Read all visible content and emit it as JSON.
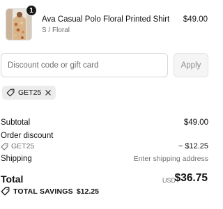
{
  "product": {
    "name": "Ava Casual Polo Floral Printed Shirt",
    "variant": "S / Floral",
    "price": "$49.00",
    "quantity": "1"
  },
  "discount": {
    "placeholder": "Discount code or gift card",
    "value": "",
    "apply_label": "Apply",
    "applied_code": "GET25"
  },
  "summary": {
    "subtotal_label": "Subtotal",
    "subtotal_value": "$49.00",
    "order_discount_label": "Order discount",
    "discount_code": "GET25",
    "discount_value": "− $12.25",
    "shipping_label": "Shipping",
    "shipping_value": "Enter shipping address",
    "total_label": "Total",
    "total_currency": "USD",
    "total_value": "$36.75",
    "savings_label": "TOTAL SAVINGS",
    "savings_value": "$12.25"
  },
  "icons": {
    "tag": "tag-icon",
    "remove": "close-icon"
  }
}
